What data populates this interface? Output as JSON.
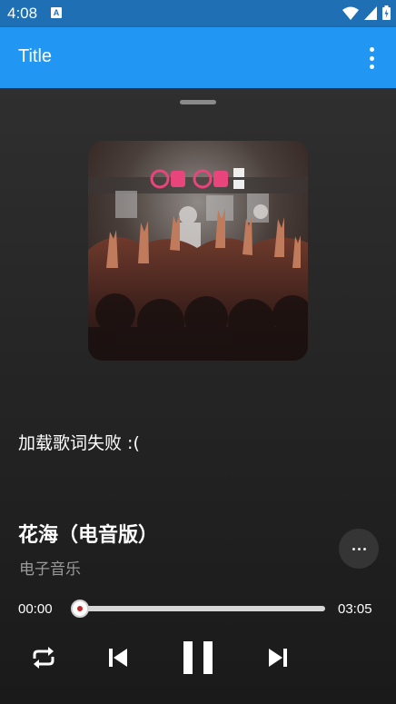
{
  "status_bar": {
    "time": "4:08",
    "app_icon_letter": "A"
  },
  "app_bar": {
    "title": "Title",
    "menu_icon": "more-vert-icon"
  },
  "player": {
    "lyrics_message": "加载歌词失败 :(",
    "song_title": "花海（电音版）",
    "artist": "电子音乐",
    "current_time": "00:00",
    "total_time": "03:05",
    "progress": 0.0,
    "album_logo_text": "咪咕音乐",
    "controls": [
      "repeat-icon",
      "skip-previous-icon",
      "pause-icon",
      "skip-next-icon"
    ]
  },
  "colors": {
    "app_bar": "#2196f3",
    "status_bar": "#1e6fb3",
    "background": "#1b1b1b",
    "logo_pink": "#e7457c"
  }
}
